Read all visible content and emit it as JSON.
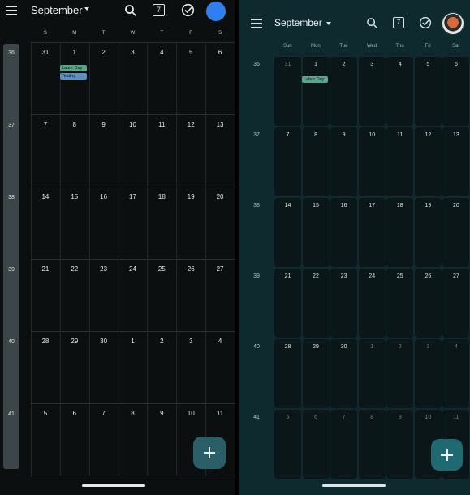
{
  "left": {
    "title": "September",
    "today_number": "7",
    "days_of_week": [
      "S",
      "M",
      "T",
      "W",
      "T",
      "F",
      "S"
    ],
    "week_numbers": [
      "36",
      "37",
      "38",
      "39",
      "40",
      "41"
    ],
    "weeks": [
      [
        "31",
        "1",
        "2",
        "3",
        "4",
        "5",
        "6"
      ],
      [
        "7",
        "8",
        "9",
        "10",
        "11",
        "12",
        "13"
      ],
      [
        "14",
        "15",
        "16",
        "17",
        "18",
        "19",
        "20"
      ],
      [
        "21",
        "22",
        "23",
        "24",
        "25",
        "26",
        "27"
      ],
      [
        "28",
        "29",
        "30",
        "1",
        "2",
        "3",
        "4"
      ],
      [
        "5",
        "6",
        "7",
        "8",
        "9",
        "10",
        "11"
      ]
    ],
    "events": [
      {
        "label": "Labor Day",
        "color": "#5aa58a"
      },
      {
        "label": "Testing",
        "color": "#5a8fc0"
      }
    ],
    "avatar_color": "#2f80ed",
    "icons": [
      "menu-icon",
      "dropdown-caret-icon",
      "search-icon",
      "today-calendar-icon",
      "tasks-check-icon",
      "plus-icon"
    ]
  },
  "right": {
    "title": "September",
    "today_number": "7",
    "days_of_week": [
      "Sun",
      "Mon",
      "Tue",
      "Wed",
      "Thu",
      "Fri",
      "Sat"
    ],
    "week_numbers": [
      "36",
      "37",
      "38",
      "39",
      "40",
      "41"
    ],
    "weeks": [
      [
        "31",
        "1",
        "2",
        "3",
        "4",
        "5",
        "6"
      ],
      [
        "7",
        "8",
        "9",
        "10",
        "11",
        "12",
        "13"
      ],
      [
        "14",
        "15",
        "16",
        "17",
        "18",
        "19",
        "20"
      ],
      [
        "21",
        "22",
        "23",
        "24",
        "25",
        "26",
        "27"
      ],
      [
        "28",
        "29",
        "30",
        "1",
        "2",
        "3",
        "4"
      ],
      [
        "5",
        "6",
        "7",
        "8",
        "9",
        "10",
        "11"
      ]
    ],
    "events": [
      {
        "label": "Labor Day",
        "color": "#5aa58a"
      }
    ],
    "accent": "#1f6a72",
    "icons": [
      "menu-icon",
      "dropdown-caret-icon",
      "search-icon",
      "today-calendar-icon",
      "tasks-check-icon",
      "plus-icon"
    ]
  }
}
